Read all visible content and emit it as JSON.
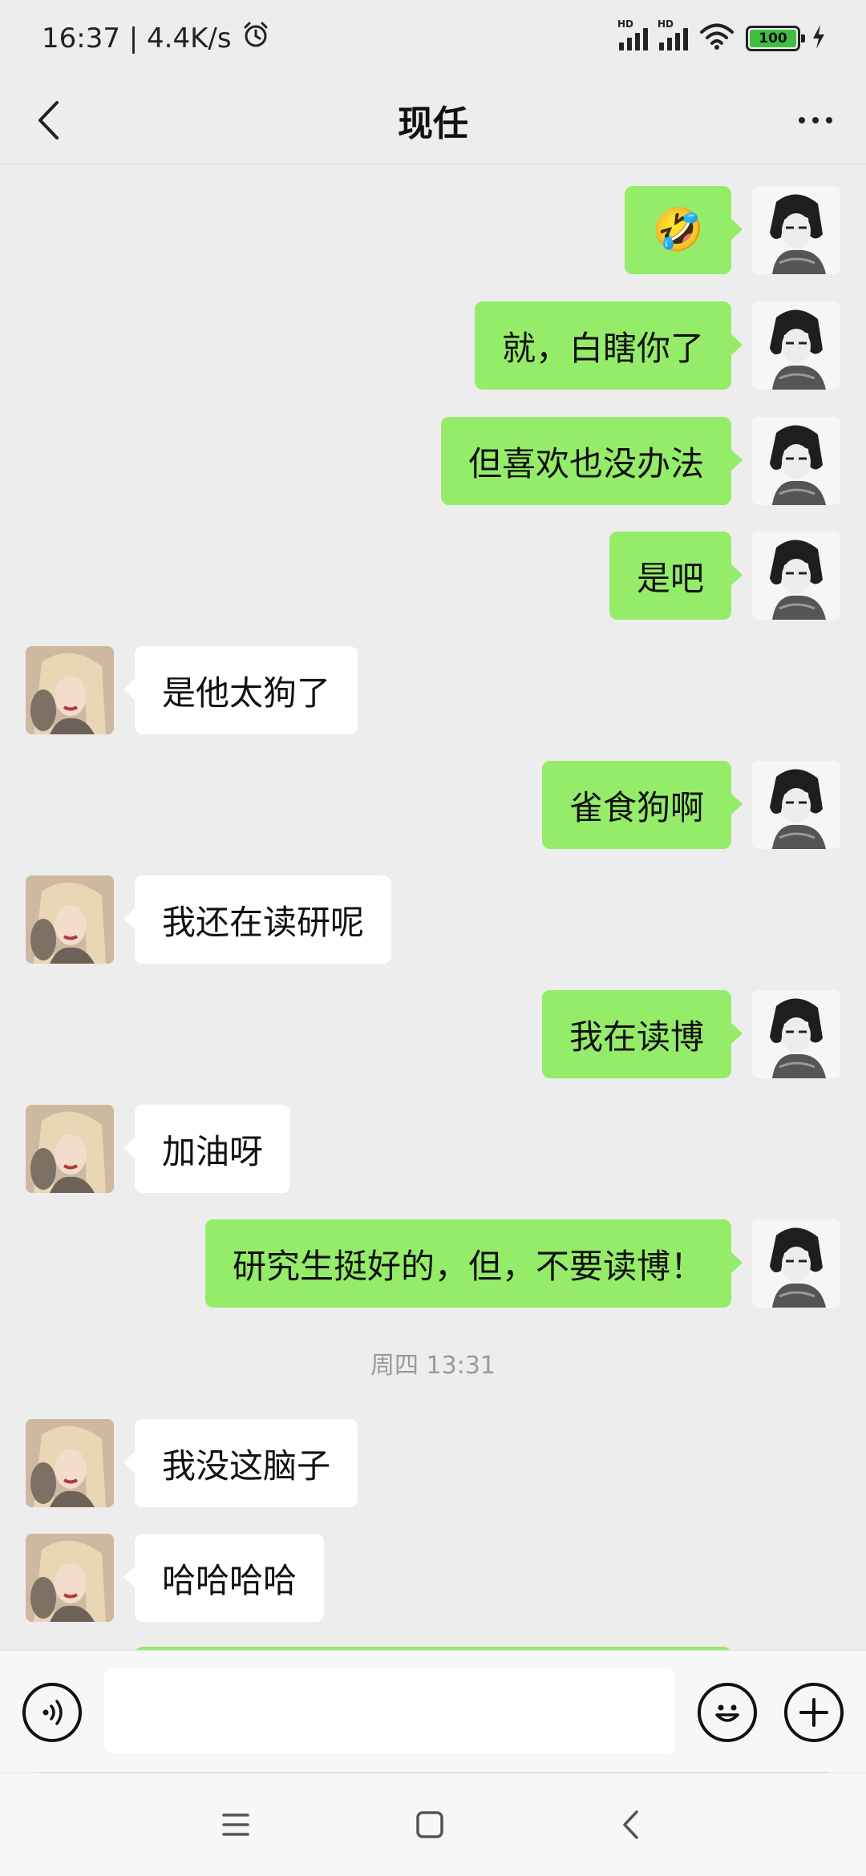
{
  "status_bar": {
    "time_speed": "16:37 | 4.4K/s",
    "battery_level": "100",
    "signal_labels": [
      "HD",
      "HD"
    ]
  },
  "header": {
    "title": "现任"
  },
  "messages": [
    {
      "side": "self",
      "text": "🤣",
      "type": "emoji"
    },
    {
      "side": "self",
      "text": "就，白瞎你了"
    },
    {
      "side": "self",
      "text": "但喜欢也没办法"
    },
    {
      "side": "self",
      "text": "是吧"
    },
    {
      "side": "other",
      "text": "是他太狗了"
    },
    {
      "side": "self",
      "text": "雀食狗啊"
    },
    {
      "side": "other",
      "text": "我还在读研呢"
    },
    {
      "side": "self",
      "text": "我在读博"
    },
    {
      "side": "other",
      "text": "加油呀"
    },
    {
      "side": "self",
      "text": "研究生挺好的，但，不要读博！"
    },
    {
      "side": "other",
      "text": "我没这脑子"
    },
    {
      "side": "other",
      "text": "哈哈哈哈"
    }
  ],
  "timestamp": "周四 13:31",
  "input": {
    "value": "",
    "placeholder": ""
  },
  "colors": {
    "self_bubble": "#95EC69",
    "other_bubble": "#FFFFFF",
    "chat_background": "#EDEDED"
  },
  "icons": [
    "back-icon",
    "more-icon",
    "voice-icon",
    "emoji-icon",
    "plus-icon",
    "menu-icon",
    "home-icon",
    "nav-back-icon"
  ]
}
